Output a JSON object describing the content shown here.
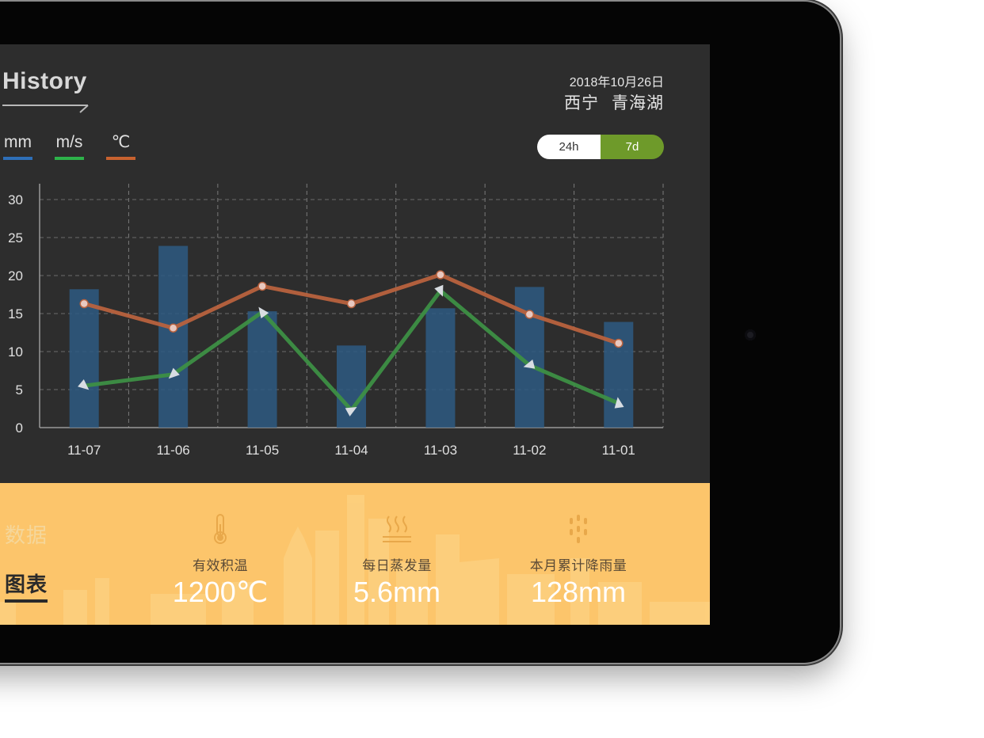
{
  "header": {
    "title": "History",
    "date": "2018年10月26日",
    "city": "西宁",
    "place": "青海湖"
  },
  "legend": [
    {
      "label": "mm",
      "color": "#2e6fb8"
    },
    {
      "label": "m/s",
      "color": "#2db24a"
    },
    {
      "label": "℃",
      "color": "#c8622f"
    }
  ],
  "range_toggle": {
    "options": [
      "24h",
      "7d"
    ],
    "selected": "7d"
  },
  "chart_data": {
    "type": "bar",
    "categories": [
      "11-07",
      "11-06",
      "11-05",
      "11-04",
      "11-03",
      "11-02",
      "11-01"
    ],
    "ylim": [
      0,
      30
    ],
    "yticks": [
      0,
      5,
      10,
      15,
      20,
      25,
      30
    ],
    "grid": true,
    "series": [
      {
        "name": "mm",
        "type": "bar",
        "color": "#2e5a82",
        "values": [
          18.2,
          23.9,
          15.3,
          10.8,
          15.7,
          18.5,
          13.9
        ]
      },
      {
        "name": "m/s",
        "type": "line",
        "color": "#3d8f44",
        "values": [
          5.5,
          7.0,
          15.2,
          2.3,
          18.0,
          8.2,
          3.2
        ]
      },
      {
        "name": "℃",
        "type": "line",
        "color": "#b8623e",
        "values": [
          16.3,
          13.1,
          18.6,
          16.3,
          20.1,
          14.9,
          11.1
        ]
      }
    ]
  },
  "bottom_panel": {
    "nav": {
      "inactive": "数据",
      "active": "图表"
    },
    "stats": [
      {
        "icon": "thermometer-icon",
        "label": "有效积温",
        "value": "1200℃"
      },
      {
        "icon": "evaporation-icon",
        "label": "每日蒸发量",
        "value": "5.6mm"
      },
      {
        "icon": "rain-icon",
        "label": "本月累计降雨量",
        "value": "128mm"
      }
    ]
  }
}
